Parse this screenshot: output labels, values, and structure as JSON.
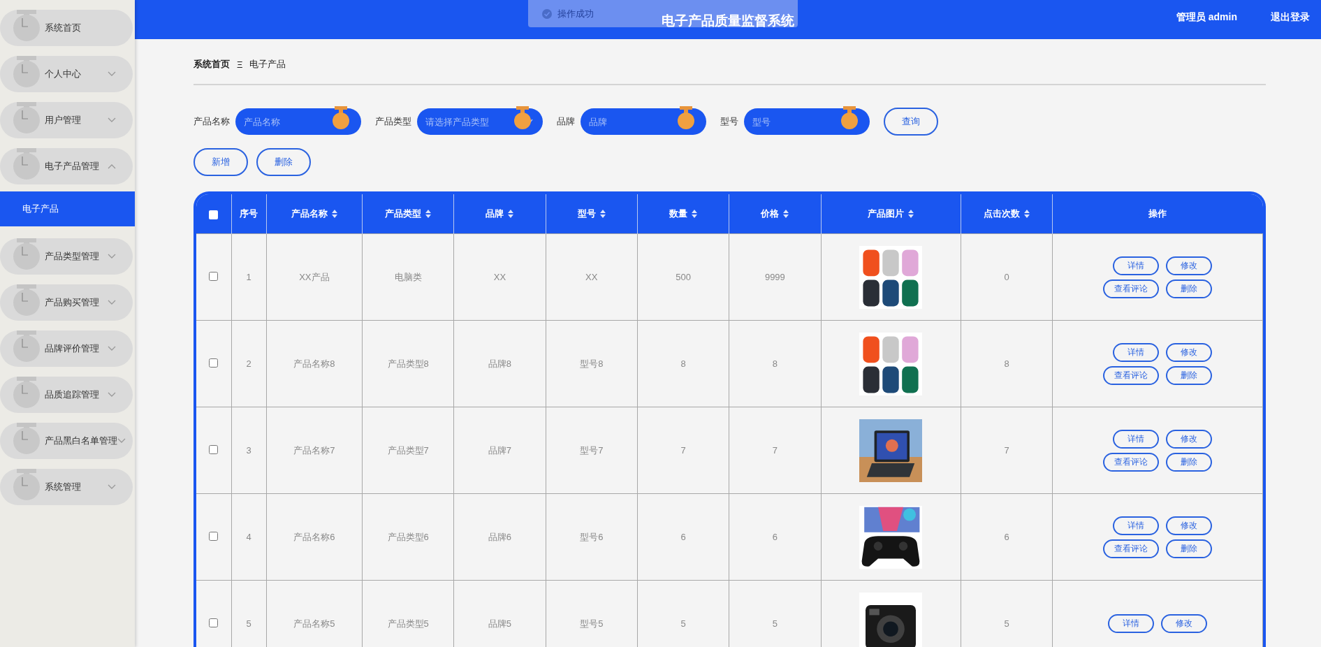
{
  "header": {
    "title": "电子产品质量监督系统",
    "user": "管理员 admin",
    "logout": "退出登录"
  },
  "toast": {
    "text": "操作成功"
  },
  "sidebar": {
    "items": [
      {
        "label": "系统首页",
        "expandable": false
      },
      {
        "label": "个人中心",
        "expandable": true,
        "expanded": false
      },
      {
        "label": "用户管理",
        "expandable": true,
        "expanded": false
      },
      {
        "label": "电子产品管理",
        "expandable": true,
        "expanded": true,
        "children": [
          {
            "label": "电子产品",
            "selected": true
          }
        ]
      },
      {
        "label": "产品类型管理",
        "expandable": true,
        "expanded": false
      },
      {
        "label": "产品购买管理",
        "expandable": true,
        "expanded": false
      },
      {
        "label": "品牌评价管理",
        "expandable": true,
        "expanded": false
      },
      {
        "label": "品质追踪管理",
        "expandable": true,
        "expanded": false
      },
      {
        "label": "产品黑白名单管理",
        "expandable": true,
        "expanded": false
      },
      {
        "label": "系统管理",
        "expandable": true,
        "expanded": false
      }
    ]
  },
  "breadcrumb": {
    "items": [
      "系统首页",
      "电子产品"
    ],
    "separator": "Ξ"
  },
  "filters": [
    {
      "label": "产品名称",
      "kind": "input",
      "placeholder": "产品名称"
    },
    {
      "label": "产品类型",
      "kind": "select",
      "placeholder": "请选择产品类型"
    },
    {
      "label": "品牌",
      "kind": "input",
      "placeholder": "品牌"
    },
    {
      "label": "型号",
      "kind": "input",
      "placeholder": "型号"
    }
  ],
  "search_button": "查询",
  "actions": [
    "新增",
    "删除"
  ],
  "table": {
    "select_all": {
      "checked": false
    },
    "columns": [
      {
        "kind": "text",
        "label": "序号",
        "sortable": false
      },
      {
        "kind": "text",
        "label": "产品名称",
        "sortable": true
      },
      {
        "kind": "text",
        "label": "产品类型",
        "sortable": true
      },
      {
        "kind": "text",
        "label": "品牌",
        "sortable": true
      },
      {
        "kind": "text",
        "label": "型号",
        "sortable": true
      },
      {
        "kind": "text",
        "label": "数量",
        "sortable": true
      },
      {
        "kind": "text",
        "label": "价格",
        "sortable": true
      },
      {
        "kind": "text",
        "label": "产品图片",
        "sortable": true
      },
      {
        "kind": "text",
        "label": "点击次数",
        "sortable": true
      },
      {
        "kind": "text",
        "label": "操作",
        "sortable": false
      }
    ],
    "rows": [
      {
        "checked": false,
        "cells": [
          "1",
          "XX产品",
          "电脑类",
          "XX",
          "XX",
          "500",
          "9999",
          {
            "kind": "picture"
          },
          "0"
        ],
        "buttons": [
          "详情",
          "修改",
          "查看评论",
          "删除"
        ]
      },
      {
        "checked": false,
        "cells": [
          "2",
          "产品名称8",
          "产品类型8",
          "品牌8",
          "型号8",
          "8",
          "8",
          {
            "kind": "picture"
          },
          "8"
        ],
        "buttons": [
          "详情",
          "修改",
          "查看评论",
          "删除"
        ]
      },
      {
        "checked": false,
        "cells": [
          "3",
          "产品名称7",
          "产品类型7",
          "品牌7",
          "型号7",
          "7",
          "7",
          {
            "kind": "picture"
          },
          "7"
        ],
        "buttons": [
          "详情",
          "修改",
          "查看评论",
          "删除"
        ]
      },
      {
        "checked": false,
        "cells": [
          "4",
          "产品名称6",
          "产品类型6",
          "品牌6",
          "型号6",
          "6",
          "6",
          {
            "kind": "picture"
          },
          "6"
        ],
        "buttons": [
          "详情",
          "修改",
          "查看评论",
          "删除"
        ]
      },
      {
        "checked": false,
        "cells": [
          "5",
          "产品名称5",
          "产品类型5",
          "品牌5",
          "型号5",
          "5",
          "5",
          {
            "kind": "picture"
          },
          "5"
        ],
        "buttons": [
          "详情",
          "修改"
        ]
      }
    ]
  }
}
